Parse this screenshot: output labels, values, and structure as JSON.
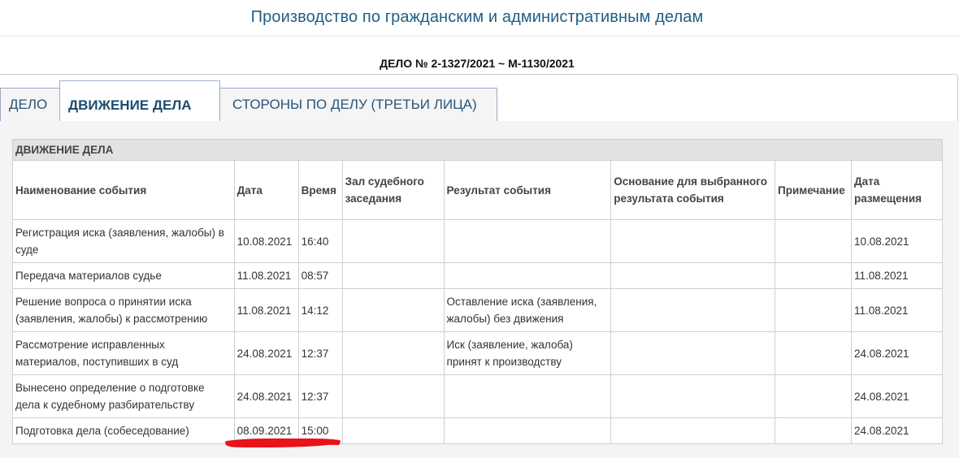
{
  "page": {
    "title": "Производство по гражданским и административным делам",
    "case_number": "ДЕЛО № 2-1327/2021 ~ М-1130/2021"
  },
  "tabs": [
    {
      "label": "ДЕЛО"
    },
    {
      "label": "ДВИЖЕНИЕ ДЕЛА"
    },
    {
      "label": "СТОРОНЫ ПО ДЕЛУ (ТРЕТЬИ ЛИЦА)"
    }
  ],
  "active_tab_index": 1,
  "table": {
    "section_title": "ДВИЖЕНИЕ ДЕЛА",
    "columns": [
      "Наименование события",
      "Дата",
      "Время",
      "Зал судебного заседания",
      "Результат события",
      "Основание для выбранного результата события",
      "Примечание",
      "Дата размещения"
    ],
    "rows": [
      {
        "event": "Регистрация иска (заявления, жалобы) в суде",
        "date": "10.08.2021",
        "time": "16:40",
        "hall": "",
        "result": "",
        "basis": "",
        "note": "",
        "posted": "10.08.2021"
      },
      {
        "event": "Передача материалов судье",
        "date": "11.08.2021",
        "time": "08:57",
        "hall": "",
        "result": "",
        "basis": "",
        "note": "",
        "posted": "11.08.2021"
      },
      {
        "event": "Решение вопроса о принятии иска (заявления, жалобы) к рассмотрению",
        "date": "11.08.2021",
        "time": "14:12",
        "hall": "",
        "result": "Оставление иска (заявления, жалобы) без движения",
        "basis": "",
        "note": "",
        "posted": "11.08.2021"
      },
      {
        "event": "Рассмотрение исправленных материалов, поступивших в суд",
        "date": "24.08.2021",
        "time": "12:37",
        "hall": "",
        "result": "Иск (заявление, жалоба) принят к производству",
        "basis": "",
        "note": "",
        "posted": "24.08.2021"
      },
      {
        "event": "Вынесено определение о подготовке дела к судебному разбирательству",
        "date": "24.08.2021",
        "time": "12:37",
        "hall": "",
        "result": "",
        "basis": "",
        "note": "",
        "posted": "24.08.2021"
      },
      {
        "event": "Подготовка дела (собеседование)",
        "date": "08.09.2021",
        "time": "15:00",
        "hall": "",
        "result": "",
        "basis": "",
        "note": "",
        "posted": "24.08.2021"
      }
    ]
  },
  "colors": {
    "title": "#1f5f86",
    "tab_text": "#2a5478",
    "section_bg": "#e2e2e2",
    "annotation": "#e8131b"
  }
}
